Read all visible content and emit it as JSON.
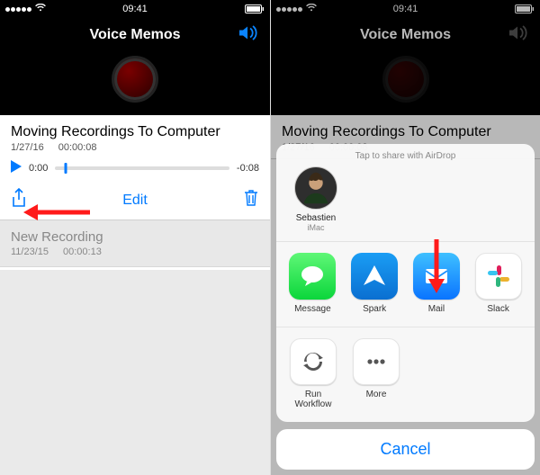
{
  "status": {
    "time": "09:41"
  },
  "app": {
    "title": "Voice Memos"
  },
  "recording": {
    "title": "Moving Recordings To Computer",
    "date": "1/27/16",
    "duration": "00:00:08",
    "elapsed": "0:00",
    "remaining": "-0:08"
  },
  "actions": {
    "edit": "Edit"
  },
  "list": {
    "items": [
      {
        "title": "New Recording",
        "date": "11/23/15",
        "duration": "00:00:13"
      }
    ]
  },
  "share": {
    "airdrop_hint": "Tap to share with AirDrop",
    "airdrop": [
      {
        "name": "Sebastien",
        "device": "iMac"
      }
    ],
    "apps": [
      {
        "label": "Message",
        "icon": "message-icon"
      },
      {
        "label": "Spark",
        "icon": "spark-icon"
      },
      {
        "label": "Mail",
        "icon": "mail-icon"
      },
      {
        "label": "Slack",
        "icon": "slack-icon"
      }
    ],
    "actions_row": [
      {
        "label": "Run Workflow",
        "icon": "workflow-icon"
      },
      {
        "label": "More",
        "icon": "more-icon"
      }
    ],
    "cancel": "Cancel"
  },
  "colors": {
    "accent": "#007aff"
  }
}
